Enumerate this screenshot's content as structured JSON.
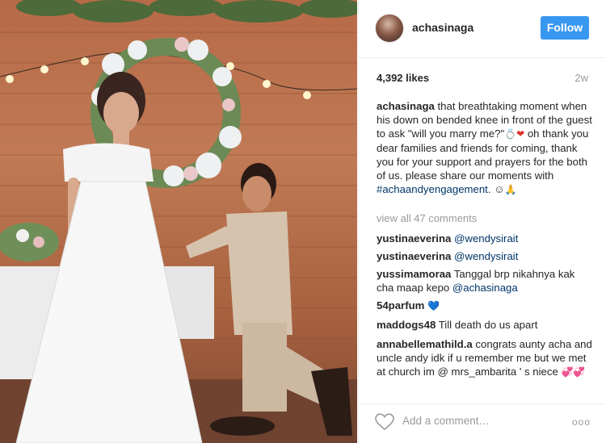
{
  "post": {
    "username": "achasinaga",
    "follow_label": "Follow",
    "likes": "4,392 likes",
    "time_ago": "2w",
    "caption": {
      "username": "achasinaga",
      "text_part1": "that breathtaking moment when his down on bended knee in front of the guest to ask \"will you marry me?\"",
      "ring_emoji": "💍",
      "heart_emoji": "❤",
      "text_part2": "oh thank you dear families and friends for coming, thank you for your support and prayers for the both of us. please share our moments with",
      "hashtag": "#achaandyengagement",
      "text_part3": ". ☺",
      "hands_emoji": "🙏"
    },
    "view_all_comments": "view all 47 comments",
    "comments": [
      {
        "user": "yustinaeverina",
        "text": "",
        "mention": "@wendysirait"
      },
      {
        "user": "yustinaeverina",
        "text": "",
        "mention": "@wendysirait"
      },
      {
        "user": "yussimamoraa",
        "text": "Tanggal brp nikahnya kak cha maap kepo",
        "mention": "@achasinaga"
      },
      {
        "user": "54parfum",
        "text": "",
        "emoji": "💙"
      },
      {
        "user": "maddogs48",
        "text": "Till death do us apart"
      },
      {
        "user": "annabellemathild.a",
        "text": "congrats aunty acha and uncle andy idk if u remember me but we met at church im @ mrs_ambarita ' s niece",
        "emoji": "💞💞"
      }
    ],
    "add_comment_placeholder": "Add a comment…",
    "more_label": "ooo"
  },
  "icons": {
    "like": "heart-outline-icon",
    "more": "more-options-icon"
  },
  "colors": {
    "follow_button": "#3897f0",
    "hashtag": "#003569",
    "muted": "#999999"
  }
}
